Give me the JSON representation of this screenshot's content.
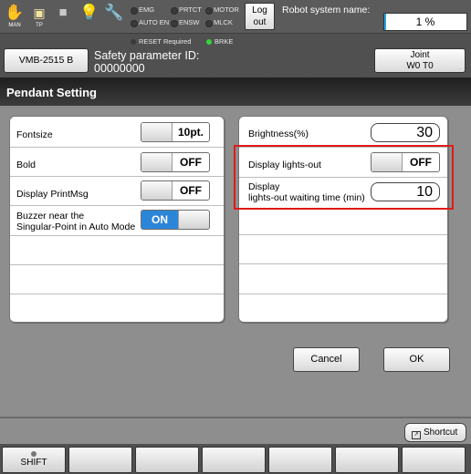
{
  "status_bar": {
    "icons": [
      {
        "name": "hand-icon",
        "caption": "MAN"
      },
      {
        "name": "teach-pendant-icon",
        "caption": "TP"
      },
      {
        "name": "stop-square-icon",
        "caption": ""
      },
      {
        "name": "lightbulb-icon",
        "caption": ""
      },
      {
        "name": "wrench-icon",
        "caption": ""
      }
    ],
    "indicators": [
      "EMG",
      "PRTCT",
      "MOTOR",
      "AUTO EN",
      "ENSW",
      "MLCK"
    ],
    "logout_label": [
      "Log",
      "out"
    ],
    "robot_name_label": "Robot system name:",
    "progress_text": "1 %",
    "progress_value": 1
  },
  "header": {
    "robot_button": "VMB-2515 B",
    "reset_indicator": "RESET Required",
    "brke_indicator": "BRKE",
    "brke_color": "#35d23b",
    "safety_label": "Safety parameter ID:",
    "safety_id": "00000000",
    "joint_button": [
      "Joint",
      "W0 T0"
    ]
  },
  "page_title": "Pendant Setting",
  "left_settings": [
    {
      "label": "Fontsize",
      "value": "10pt.",
      "kind": "toggle-off"
    },
    {
      "label": "Bold",
      "value": "OFF",
      "kind": "toggle-off"
    },
    {
      "label": "Display PrintMsg",
      "value": "OFF",
      "kind": "toggle-off"
    },
    {
      "label_lines": [
        "Buzzer near the",
        "Singular-Point in Auto Mode"
      ],
      "value": "ON",
      "kind": "toggle-on"
    }
  ],
  "right_settings": [
    {
      "label": "Brightness(%)",
      "value": "30",
      "kind": "number"
    },
    {
      "label": "Display lights-out",
      "value": "OFF",
      "kind": "toggle-off"
    },
    {
      "label_lines": [
        "Display",
        "lights-out waiting time (min)"
      ],
      "value": "10",
      "kind": "number"
    }
  ],
  "highlight_color": "#e01a1a",
  "buttons": {
    "cancel": "Cancel",
    "ok": "OK"
  },
  "shortcut_label": "Shortcut",
  "function_keys": [
    "SHIFT",
    "",
    "",
    "",
    "",
    "",
    "",
    ""
  ]
}
